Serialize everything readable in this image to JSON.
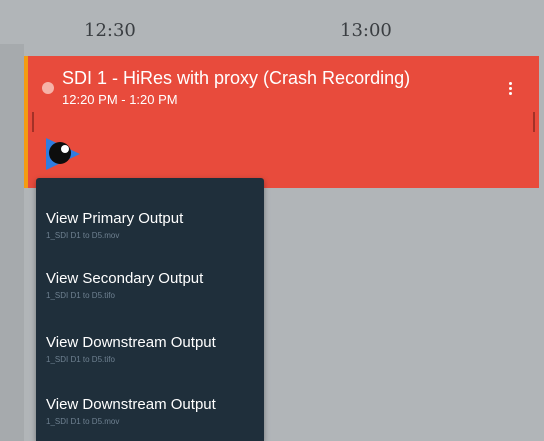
{
  "timeline": {
    "times": [
      "12:30",
      "13:00"
    ]
  },
  "recording": {
    "title": "SDI 1 - HiRes with proxy (Crash Recording)",
    "time_range": "12:20 PM - 1:20 PM",
    "color": "#e84b3c",
    "accent_color": "#f39c12",
    "status_icon": "status-dot-icon",
    "menu_icon": "kebab-menu-icon",
    "preview_icon": "eye-icon"
  },
  "output_menu": {
    "items": [
      {
        "label": "View Primary Output",
        "file": "1_SDI D1 to D5.mov"
      },
      {
        "label": "View Secondary Output",
        "file": "1_SDI D1 to D5.tifo"
      },
      {
        "label": "View Downstream Output",
        "file": "1_SDI D1 to D5.tifo"
      },
      {
        "label": "View Downstream Output",
        "file": "1_SDI D1 to D5.mov"
      }
    ]
  }
}
